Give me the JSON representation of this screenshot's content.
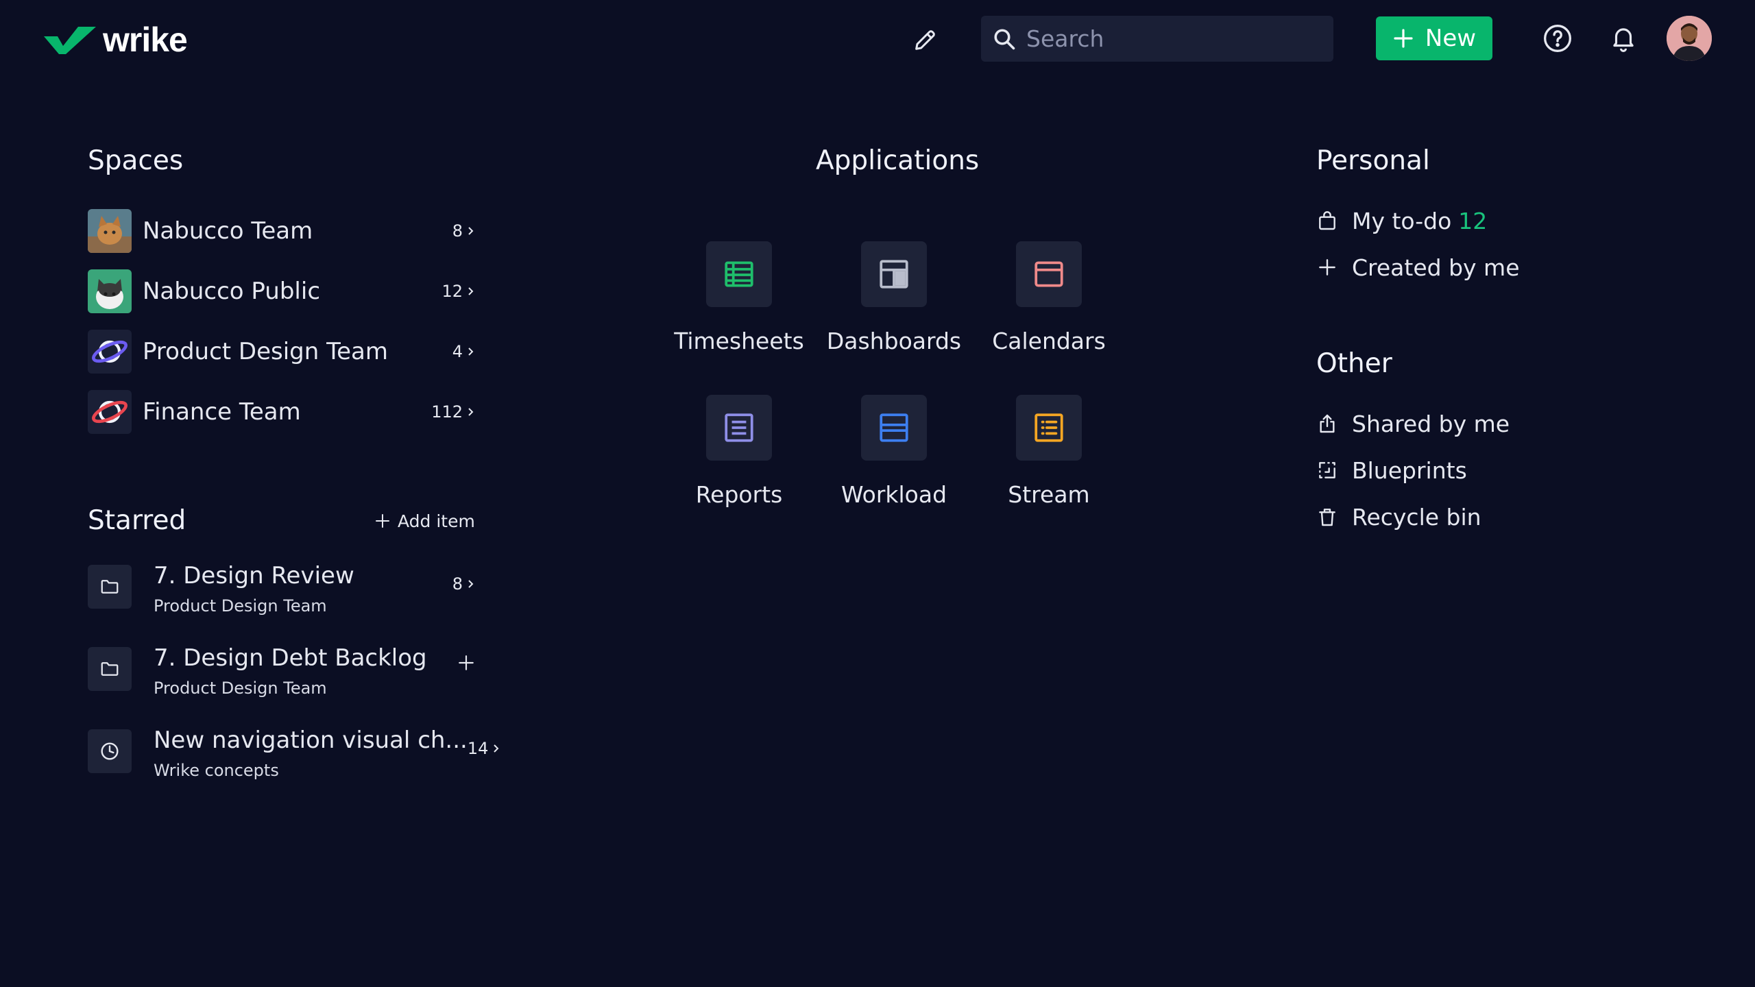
{
  "header": {
    "logo_text": "wrike",
    "search_placeholder": "Search",
    "new_label": "New"
  },
  "colors": {
    "background": "#0b0e23",
    "accent_green": "#08b56c",
    "tile_bg": "#1e2338"
  },
  "spaces": {
    "title": "Spaces",
    "items": [
      {
        "label": "Nabucco Team",
        "count": "8"
      },
      {
        "label": "Nabucco Public",
        "count": "12"
      },
      {
        "label": "Product Design Team",
        "count": "4"
      },
      {
        "label": "Finance Team",
        "count": "112"
      }
    ]
  },
  "starred": {
    "title": "Starred",
    "add_label": "Add item",
    "items": [
      {
        "title": "7. Design Review",
        "subtitle": "Product Design Team",
        "count": "8",
        "icon": "folder-icon"
      },
      {
        "title": "7. Design Debt Backlog",
        "subtitle": "Product Design Team",
        "count": "",
        "icon": "folder-icon"
      },
      {
        "title": "New navigation visual ch...",
        "subtitle": "Wrike concepts",
        "count": "14",
        "icon": "project-icon"
      }
    ]
  },
  "applications": {
    "title": "Applications",
    "items": [
      {
        "label": "Timesheets",
        "icon": "timesheets-icon",
        "color": "#1fbf6b"
      },
      {
        "label": "Dashboards",
        "icon": "dashboards-icon",
        "color": "#b9bdcc"
      },
      {
        "label": "Calendars",
        "icon": "calendars-icon",
        "color": "#f08a8a"
      },
      {
        "label": "Reports",
        "icon": "reports-icon",
        "color": "#8f8fe8"
      },
      {
        "label": "Workload",
        "icon": "workload-icon",
        "color": "#3d7ff0"
      },
      {
        "label": "Stream",
        "icon": "stream-icon",
        "color": "#f5a623"
      }
    ]
  },
  "personal": {
    "title": "Personal",
    "todo_label": "My to-do",
    "todo_count": "12",
    "created_label": "Created by me"
  },
  "other": {
    "title": "Other",
    "shared_label": "Shared by me",
    "blueprints_label": "Blueprints",
    "recycle_label": "Recycle bin"
  }
}
